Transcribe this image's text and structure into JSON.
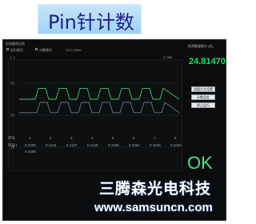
{
  "banner": {
    "title": "Pin针计数"
  },
  "window": {
    "title": "检测量测试验",
    "toolbar": {
      "option_a": "运行模式",
      "option_b": "计数模式",
      "readout": "CH 1 200V"
    },
    "y_top_label": "1. 1",
    "y_right_label": "0. 000"
  },
  "measurement": {
    "label": "检测数量统计 (位)",
    "value": "24.81470",
    "color": "#19e36b"
  },
  "buttons": [
    {
      "label": "测量方式设置"
    },
    {
      "label": "计数设定"
    },
    {
      "label": "停止运行"
    }
  ],
  "chart_data": {
    "type": "line",
    "y_ticks": [
      "25",
      "20",
      "15"
    ],
    "series": [
      {
        "color": "#3ad06b",
        "x": [
          0,
          20,
          24,
          33,
          37,
          46,
          50,
          59,
          63,
          72,
          76,
          85,
          89,
          98,
          102,
          111,
          115,
          124,
          128,
          137,
          141,
          150,
          154,
          163,
          167,
          176,
          180,
          200
        ],
        "y": [
          22.5,
          22.5,
          24.2,
          24.2,
          22.5,
          22.5,
          24.2,
          24.2,
          22.5,
          22.5,
          24.2,
          24.2,
          22.5,
          22.5,
          24.2,
          24.2,
          22.5,
          22.5,
          24.2,
          24.2,
          22.5,
          22.5,
          24.2,
          24.2,
          22.5,
          22.5,
          24.2,
          22.5
        ]
      },
      {
        "color": "#6c7a82",
        "x": [
          0,
          22,
          26,
          35,
          39,
          48,
          52,
          61,
          65,
          74,
          78,
          87,
          91,
          100,
          104,
          113,
          117,
          126,
          130,
          139,
          143,
          152,
          156,
          165,
          169,
          178,
          182,
          200
        ],
        "y": [
          20.4,
          20.4,
          22.0,
          22.0,
          20.4,
          20.4,
          22.0,
          22.0,
          20.4,
          20.4,
          22.0,
          22.0,
          20.4,
          20.4,
          22.0,
          22.0,
          20.4,
          20.4,
          22.0,
          22.0,
          20.4,
          20.4,
          22.0,
          22.0,
          20.4,
          20.4,
          22.0,
          20.4
        ]
      }
    ],
    "ylim": [
      12,
      28
    ],
    "xlim": [
      0,
      200
    ],
    "grid": true
  },
  "table": {
    "header_label": "序号",
    "columns": [
      "1",
      "2",
      "3",
      "4",
      "5",
      "6",
      "7",
      "8"
    ],
    "row_label": "序号1",
    "values": [
      "0.1036",
      "0.1134",
      "0.1167",
      "0.1125",
      "0.1036",
      "0.1064",
      "0.1046",
      "0.1034"
    ],
    "extra_value": "0.4298"
  },
  "status": {
    "result": "OK"
  },
  "watermark": {
    "company": "三腾森光电科技",
    "url": "www.samsuncn.com"
  }
}
